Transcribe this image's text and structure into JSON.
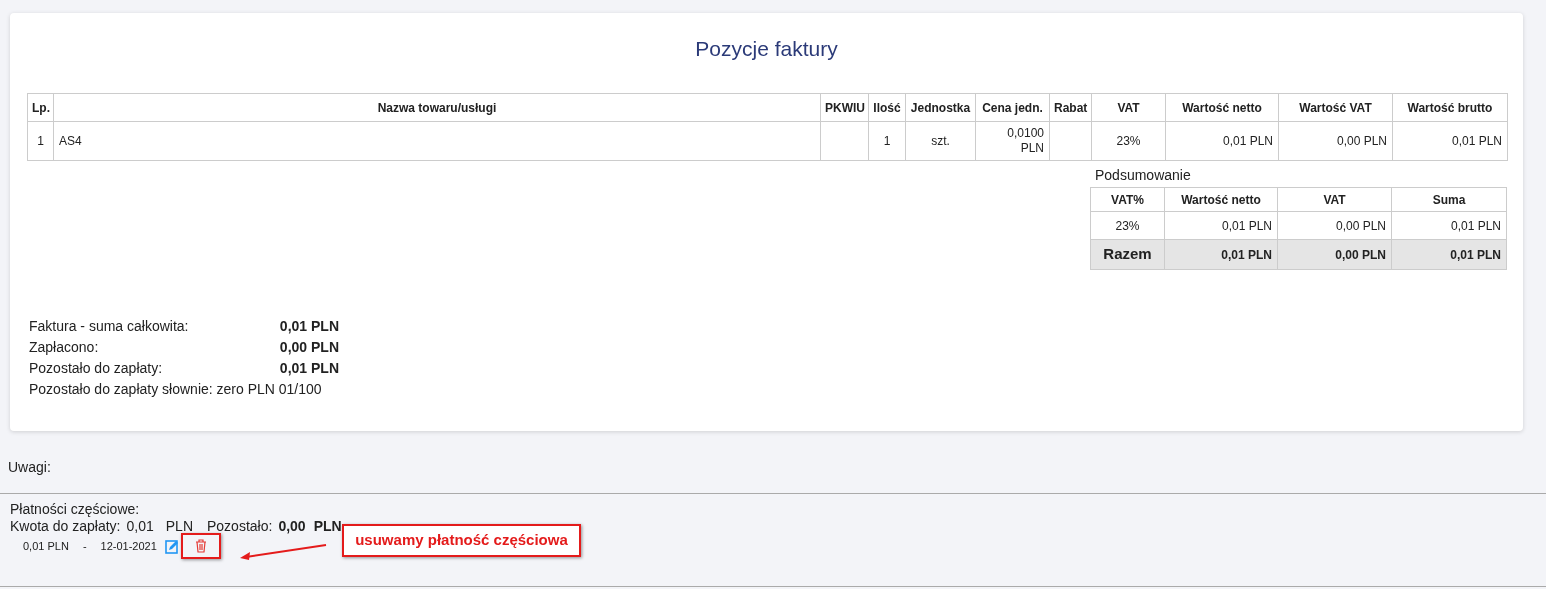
{
  "title": "Pozycje faktury",
  "items_table": {
    "columns": [
      "Lp.",
      "Nazwa towaru/usługi",
      "PKWIU",
      "Ilość",
      "Jednostka",
      "Cena jedn.",
      "Rabat",
      "VAT",
      "Wartość netto",
      "Wartość VAT",
      "Wartość brutto"
    ],
    "rows": [
      [
        "1",
        "AS4",
        "",
        "1",
        "szt.",
        "0,0100 PLN",
        "",
        "23%",
        "0,01 PLN",
        "0,00 PLN",
        "0,01 PLN"
      ]
    ]
  },
  "summary": {
    "title": "Podsumowanie",
    "columns": [
      "VAT%",
      "Wartość netto",
      "VAT",
      "Suma"
    ],
    "rows": [
      [
        "23%",
        "0,01 PLN",
        "0,00 PLN",
        "0,01 PLN"
      ]
    ],
    "total": [
      "Razem",
      "0,01 PLN",
      "0,00 PLN",
      "0,01 PLN"
    ]
  },
  "totals": [
    {
      "label": "Faktura - suma całkowita:",
      "value": "0,01 PLN"
    },
    {
      "label": "Zapłacono:",
      "value": "0,00 PLN"
    },
    {
      "label": "Pozostało do zapłaty:",
      "value": "0,01 PLN"
    }
  ],
  "in_words": "Pozostało do zapłaty słownie: zero PLN 01/100",
  "notes_label": "Uwagi:",
  "partial": {
    "title": "Płatności częściowe:",
    "due_label": "Kwota do zapłaty:",
    "due_amount": "0,01",
    "due_currency": "PLN",
    "left_label": "Pozostało:",
    "left_amount": "0,00",
    "left_currency": "PLN",
    "payments": [
      {
        "amount": "0,01 PLN",
        "sep": "-",
        "date": "12-01-2021",
        "highlighted": true
      }
    ]
  },
  "annotation": "usuwamy płatność częściowa"
}
